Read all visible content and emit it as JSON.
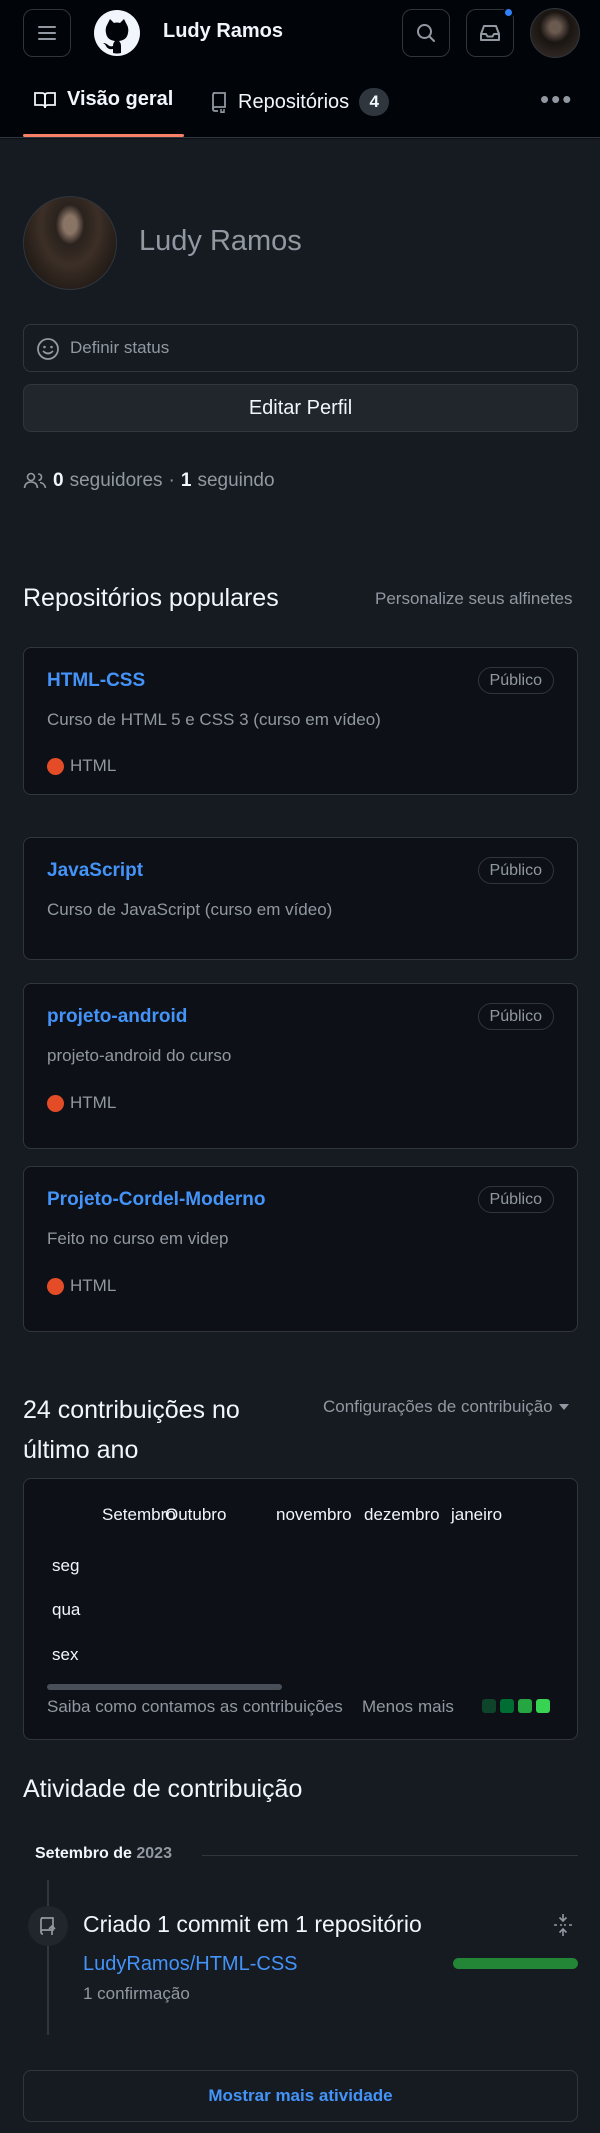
{
  "header": {
    "username": "Ludy Ramos",
    "icons": [
      "hamburger-menu-icon",
      "github-logo",
      "search-icon",
      "inbox-icon",
      "avatar"
    ],
    "notification_color": "#2f81f7"
  },
  "tabs": [
    {
      "label": "Visão geral",
      "icon": "book-open-icon",
      "selected": true
    },
    {
      "label": "Repositórios",
      "icon": "repo-icon",
      "count": "4"
    }
  ],
  "profile": {
    "name": "Ludy Ramos",
    "status_placeholder": "Definir status",
    "edit_label": "Editar Perfil",
    "followers_count": "0",
    "followers_label": "seguidores",
    "separator": "·",
    "following_count": "1",
    "following_label": "seguindo"
  },
  "popular": {
    "title": "Repositórios populares",
    "customize": "Personalize seus alfinetes",
    "repos": [
      {
        "name": "HTML-CSS",
        "visibility": "Público",
        "description": "Curso de HTML 5 e CSS 3 (curso em vídeo)",
        "language": "HTML"
      },
      {
        "name": "JavaScript",
        "visibility": "Público",
        "description": "Curso de JavaScript (curso em vídeo)",
        "language": ""
      },
      {
        "name": "projeto-android",
        "visibility": "Público",
        "description": "projeto-android do curso",
        "language": "HTML"
      },
      {
        "name": "Projeto-Cordel-Moderno",
        "visibility": "Público",
        "description": "Feito no curso em videp",
        "language": "HTML"
      }
    ],
    "language_color": "#e34c26"
  },
  "contributions": {
    "title": "24 contribuições no último ano",
    "settings": "Configurações de contribuição",
    "months": [
      "Setembro",
      "Outubro",
      "novembro",
      "dezembro",
      "janeiro"
    ],
    "days": [
      "seg",
      "qua",
      "sex"
    ],
    "how_link": "Saiba como contamos as contribuições",
    "less": "Menos",
    "more": "mais",
    "legend_colors": [
      "#0e4429",
      "#006d32",
      "#26a641",
      "#39d353"
    ]
  },
  "activity": {
    "title": "Atividade de contribuição",
    "month": "Setembro de",
    "year": "2023",
    "item_text": "Criado 1 commit em 1 repositório",
    "repo": "LudyRamos/HTML-CSS",
    "confirmations": "1 confirmação",
    "bar_fraction": 1.0,
    "show_more": "Mostrar mais atividade"
  }
}
